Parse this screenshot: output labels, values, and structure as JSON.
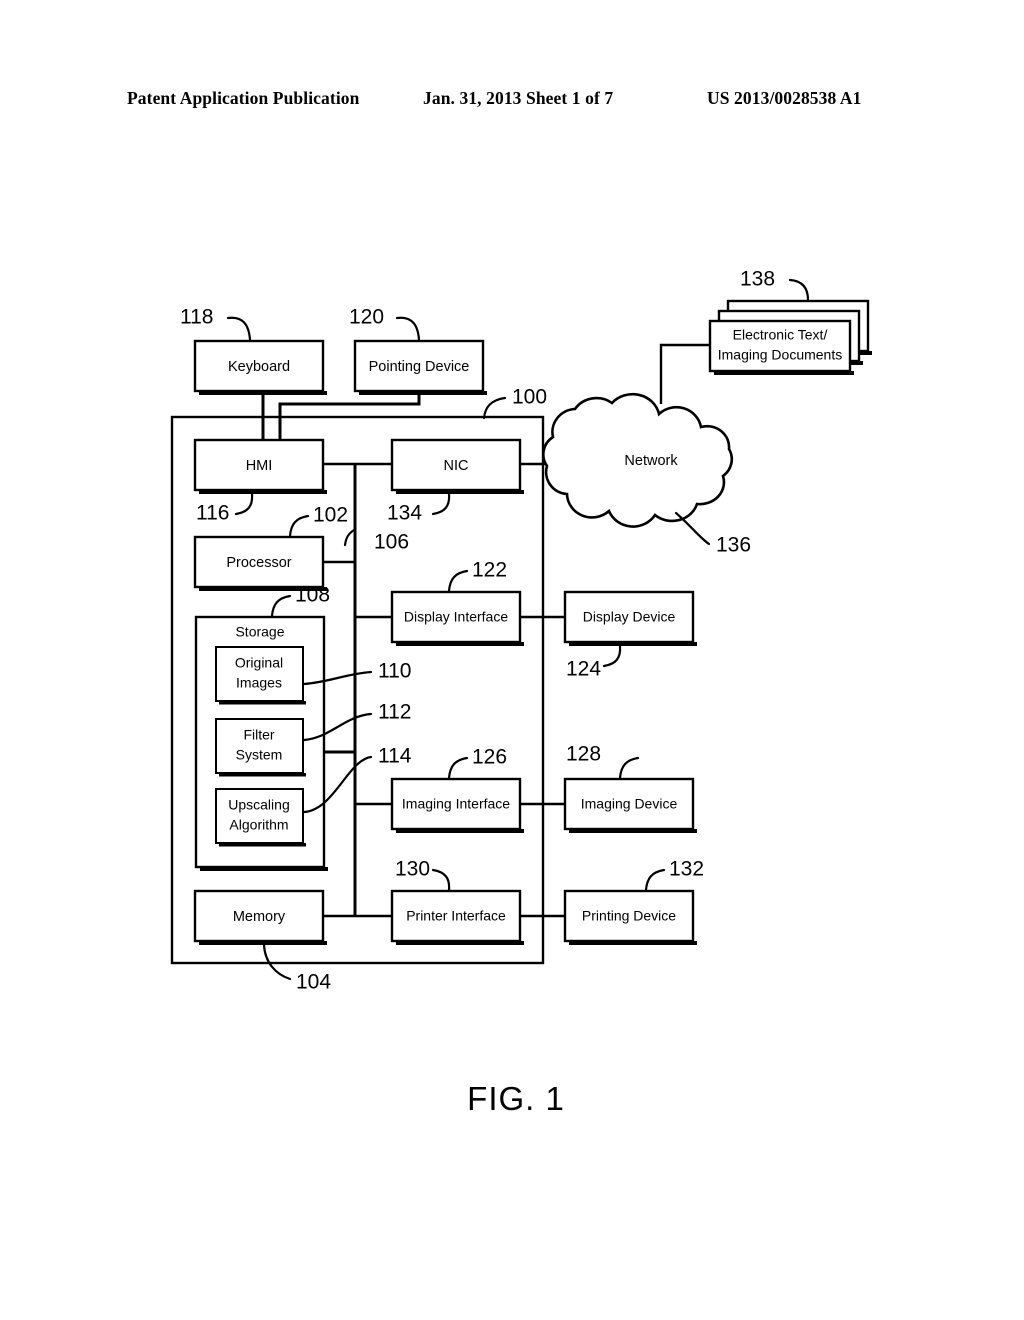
{
  "header": {
    "left": "Patent Application Publication",
    "middle": "Jan. 31, 2013  Sheet 1 of 7",
    "right": "US 2013/0028538 A1"
  },
  "figure": {
    "caption": "FIG. 1",
    "boxes": {
      "keyboard": "Keyboard",
      "pointing_device": "Pointing Device",
      "hmi": "HMI",
      "nic": "NIC",
      "processor": "Processor",
      "storage": "Storage",
      "original_images_l1": "Original",
      "original_images_l2": "Images",
      "filter_system_l1": "Filter",
      "filter_system_l2": "System",
      "upscaling_l1": "Upscaling",
      "upscaling_l2": "Algorithm",
      "memory": "Memory",
      "display_interface": "Display Interface",
      "display_device": "Display Device",
      "imaging_interface": "Imaging Interface",
      "imaging_device": "Imaging Device",
      "printer_interface": "Printer Interface",
      "printing_device": "Printing Device",
      "network": "Network",
      "documents_l1": "Electronic Text/",
      "documents_l2": "Imaging Documents"
    },
    "reference_numerals": {
      "system": "100",
      "processor": "102",
      "computing_device": "104",
      "bus": "106",
      "storage": "108",
      "original_images": "110",
      "filter_system": "112",
      "upscaling_algorithm": "114",
      "hmi": "116",
      "keyboard": "118",
      "pointing_device": "120",
      "display_interface": "122",
      "display_device": "124",
      "imaging_interface": "126",
      "imaging_device": "128",
      "printer_interface": "130",
      "printing_device": "132",
      "nic": "134",
      "network": "136",
      "documents": "138"
    }
  },
  "colors": {
    "ink": "#000000",
    "paper": "#ffffff"
  }
}
